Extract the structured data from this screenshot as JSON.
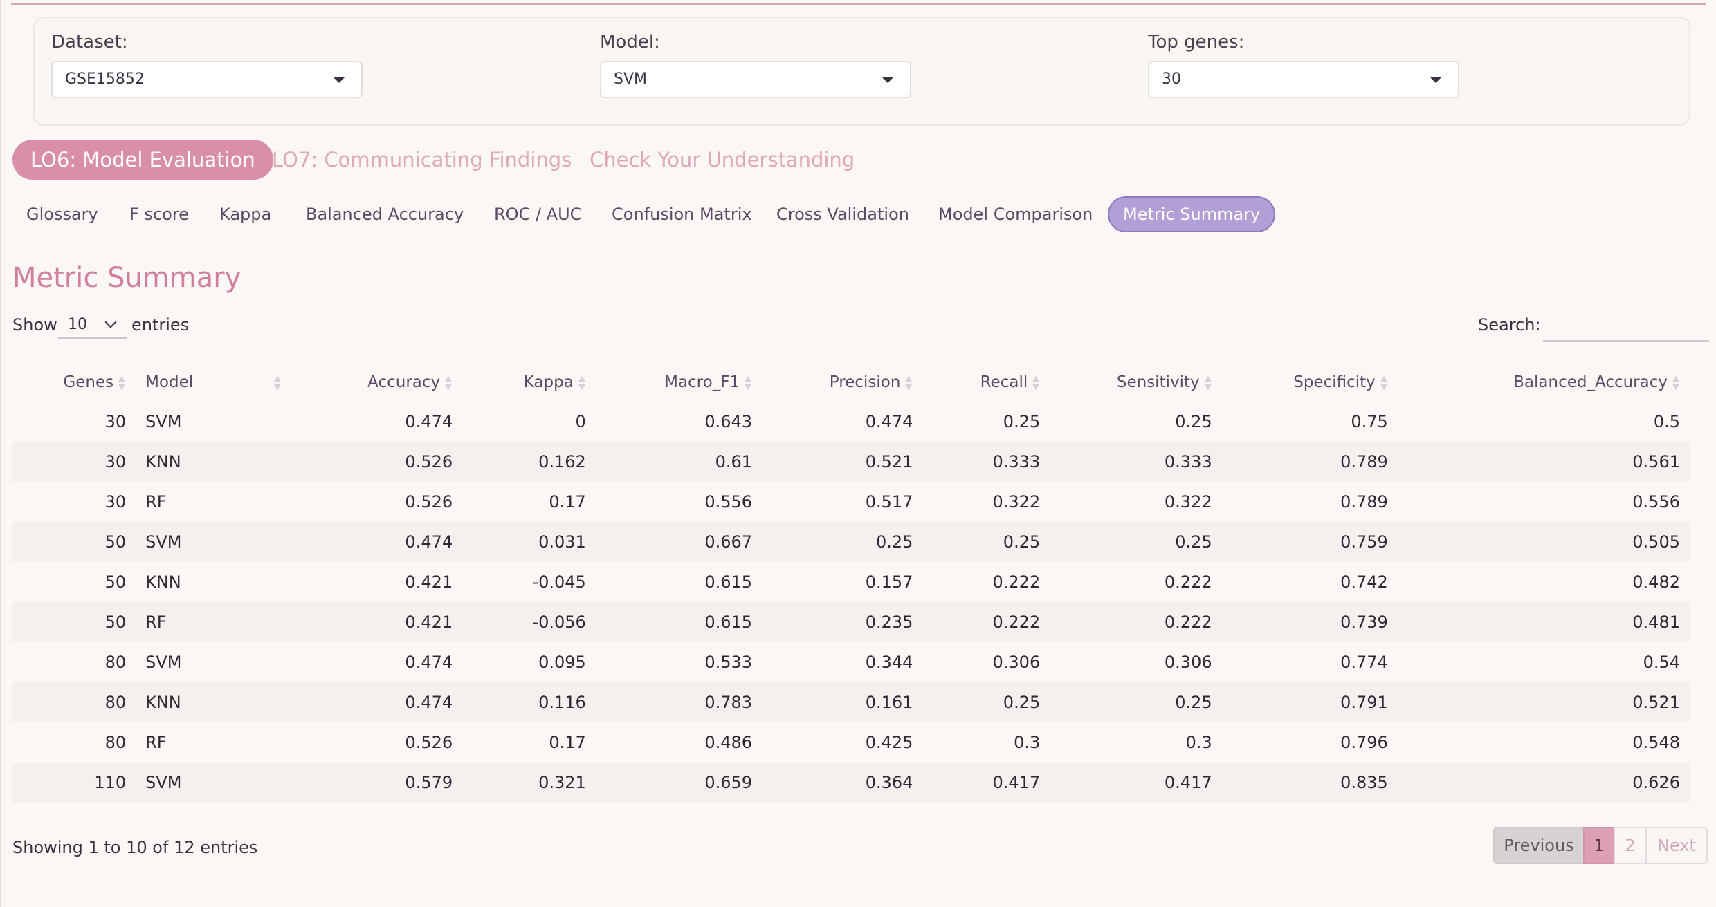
{
  "controls": {
    "dataset": {
      "label": "Dataset:",
      "value": "GSE15852"
    },
    "model": {
      "label": "Model:",
      "value": "SVM"
    },
    "top_genes": {
      "label": "Top genes:",
      "value": "30"
    }
  },
  "main_tabs": [
    {
      "label": "LO6: Model Evaluation",
      "active": true
    },
    {
      "label": "LO7: Communicating Findings",
      "active": false
    },
    {
      "label": "Check Your Understanding",
      "active": false
    }
  ],
  "sub_tabs": [
    {
      "label": "Glossary"
    },
    {
      "label": "F score"
    },
    {
      "label": "Kappa"
    },
    {
      "label": "Balanced Accuracy"
    },
    {
      "label": "ROC / AUC"
    },
    {
      "label": "Confusion Matrix"
    },
    {
      "label": "Cross Validation"
    },
    {
      "label": "Model Comparison"
    },
    {
      "label": "Metric Summary",
      "active": true
    }
  ],
  "section_title": "Metric Summary",
  "table_controls": {
    "show_label": "Show",
    "length_value": "10",
    "entries_label": "entries",
    "search_label": "Search:",
    "search_value": ""
  },
  "table": {
    "columns": [
      "Genes",
      "Model",
      "Accuracy",
      "Kappa",
      "Macro_F1",
      "Precision",
      "Recall",
      "Sensitivity",
      "Specificity",
      "Balanced_Accuracy"
    ],
    "rows": [
      [
        "30",
        "SVM",
        "0.474",
        "0",
        "0.643",
        "0.474",
        "0.25",
        "0.25",
        "0.75",
        "0.5"
      ],
      [
        "30",
        "KNN",
        "0.526",
        "0.162",
        "0.61",
        "0.521",
        "0.333",
        "0.333",
        "0.789",
        "0.561"
      ],
      [
        "30",
        "RF",
        "0.526",
        "0.17",
        "0.556",
        "0.517",
        "0.322",
        "0.322",
        "0.789",
        "0.556"
      ],
      [
        "50",
        "SVM",
        "0.474",
        "0.031",
        "0.667",
        "0.25",
        "0.25",
        "0.25",
        "0.759",
        "0.505"
      ],
      [
        "50",
        "KNN",
        "0.421",
        "-0.045",
        "0.615",
        "0.157",
        "0.222",
        "0.222",
        "0.742",
        "0.482"
      ],
      [
        "50",
        "RF",
        "0.421",
        "-0.056",
        "0.615",
        "0.235",
        "0.222",
        "0.222",
        "0.739",
        "0.481"
      ],
      [
        "80",
        "SVM",
        "0.474",
        "0.095",
        "0.533",
        "0.344",
        "0.306",
        "0.306",
        "0.774",
        "0.54"
      ],
      [
        "80",
        "KNN",
        "0.474",
        "0.116",
        "0.783",
        "0.161",
        "0.25",
        "0.25",
        "0.791",
        "0.521"
      ],
      [
        "80",
        "RF",
        "0.526",
        "0.17",
        "0.486",
        "0.425",
        "0.3",
        "0.3",
        "0.796",
        "0.548"
      ],
      [
        "110",
        "SVM",
        "0.579",
        "0.321",
        "0.659",
        "0.364",
        "0.417",
        "0.417",
        "0.835",
        "0.626"
      ]
    ]
  },
  "footer": {
    "info": "Showing 1 to 10 of 12 entries",
    "pagination": {
      "previous": "Previous",
      "pages": [
        "1",
        "2"
      ],
      "current": "1",
      "next": "Next"
    }
  },
  "colors": {
    "accent_pink": "#d98fa7",
    "accent_purple": "#b19fd6",
    "title_pink": "#d0809c"
  }
}
